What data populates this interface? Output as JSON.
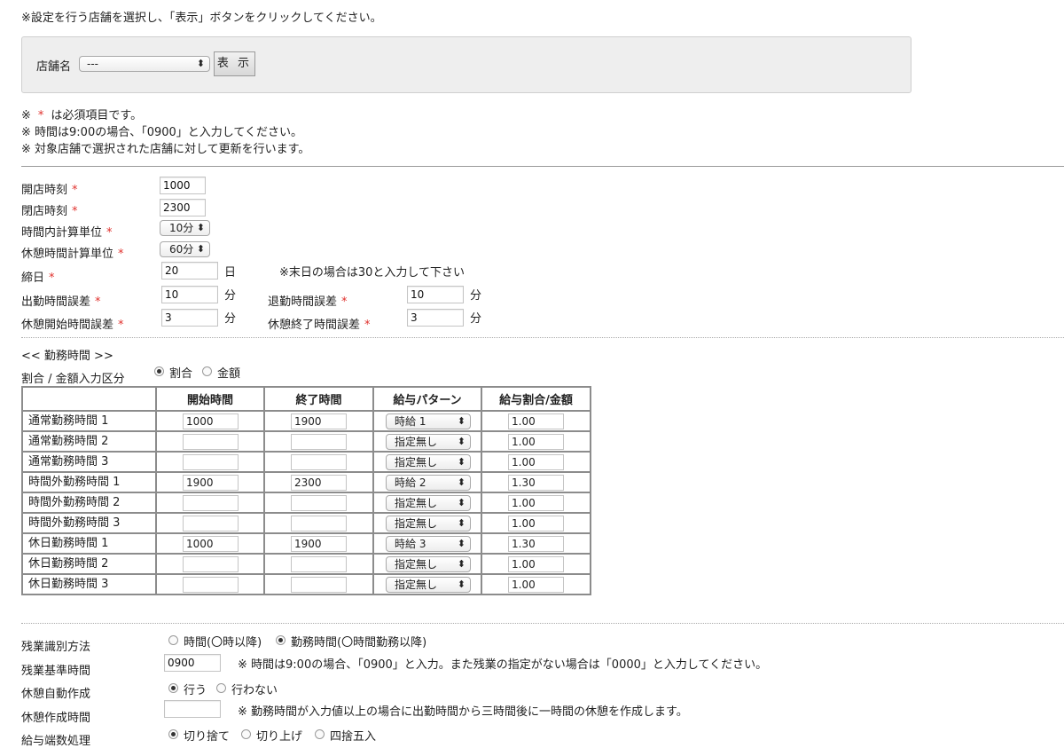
{
  "instruction": "※設定を行う店舗を選択し、「表示」ボタンをクリックしてください。",
  "store_filter": {
    "label": "店舗名",
    "selected": "---",
    "button": "表 示"
  },
  "notes": {
    "prefix": "※",
    "required_mark": "*",
    "required_suffix": "は必須項目です。",
    "line2": "※ 時間は9:00の場合、「0900」と入力してください。",
    "line3": "※ 対象店舗で選択された店舗に対して更新を行います。"
  },
  "settings": {
    "open_time": {
      "label": "開店時刻",
      "value": "1000"
    },
    "close_time": {
      "label": "閉店時刻",
      "value": "2300"
    },
    "time_unit": {
      "label": "時間内計算単位",
      "selected": "10分"
    },
    "break_unit": {
      "label": "休憩時間計算単位",
      "selected": "60分"
    },
    "closing_day": {
      "label": "締日",
      "value": "20",
      "unit": "日",
      "note": "※末日の場合は30と入力して下さい"
    },
    "clockin_error": {
      "label": "出勤時間誤差",
      "value": "10",
      "unit": "分"
    },
    "clockout_error": {
      "label": "退勤時間誤差",
      "value": "10",
      "unit": "分"
    },
    "break_start_error": {
      "label": "休憩開始時間誤差",
      "value": "3",
      "unit": "分"
    },
    "break_end_error": {
      "label": "休憩終了時間誤差",
      "value": "3",
      "unit": "分"
    }
  },
  "work_hours": {
    "title": "<< 勤務時間 >>",
    "input_type": {
      "label": "割合 / 金額入力区分",
      "options": [
        "割合",
        "金額"
      ],
      "selected": "割合"
    },
    "headers": [
      "開始時間",
      "終了時間",
      "給与パターン",
      "給与割合/金額"
    ],
    "rows": [
      {
        "label": "通常勤務時間 1",
        "start": "1000",
        "end": "1900",
        "pattern": "時給 1",
        "rate": "1.00"
      },
      {
        "label": "通常勤務時間 2",
        "start": "",
        "end": "",
        "pattern": "指定無し",
        "rate": "1.00"
      },
      {
        "label": "通常勤務時間 3",
        "start": "",
        "end": "",
        "pattern": "指定無し",
        "rate": "1.00"
      },
      {
        "label": "時間外勤務時間 1",
        "start": "1900",
        "end": "2300",
        "pattern": "時給 2",
        "rate": "1.30"
      },
      {
        "label": "時間外勤務時間 2",
        "start": "",
        "end": "",
        "pattern": "指定無し",
        "rate": "1.00"
      },
      {
        "label": "時間外勤務時間 3",
        "start": "",
        "end": "",
        "pattern": "指定無し",
        "rate": "1.00"
      },
      {
        "label": "休日勤務時間 1",
        "start": "1000",
        "end": "1900",
        "pattern": "時給 3",
        "rate": "1.30"
      },
      {
        "label": "休日勤務時間 2",
        "start": "",
        "end": "",
        "pattern": "指定無し",
        "rate": "1.00"
      },
      {
        "label": "休日勤務時間 3",
        "start": "",
        "end": "",
        "pattern": "指定無し",
        "rate": "1.00"
      }
    ]
  },
  "overtime": {
    "method": {
      "label": "残業識別方法",
      "options": [
        "時間(〇時以降)",
        "勤務時間(〇時間勤務以降)"
      ],
      "selected": "勤務時間(〇時間勤務以降)"
    },
    "base_time": {
      "label": "残業基準時間",
      "value": "0900",
      "note": "※ 時間は9:00の場合、「0900」と入力。また残業の指定がない場合は「0000」と入力してください。"
    },
    "auto_break": {
      "label": "休憩自動作成",
      "options": [
        "行う",
        "行わない"
      ],
      "selected": "行う"
    },
    "break_create_time": {
      "label": "休憩作成時間",
      "value": "",
      "note": "※ 勤務時間が入力値以上の場合に出勤時間から三時間後に一時間の休憩を作成します。"
    },
    "rounding": {
      "label": "給与端数処理",
      "options": [
        "切り捨て",
        "切り上げ",
        "四捨五入"
      ],
      "selected": "切り捨て"
    }
  }
}
